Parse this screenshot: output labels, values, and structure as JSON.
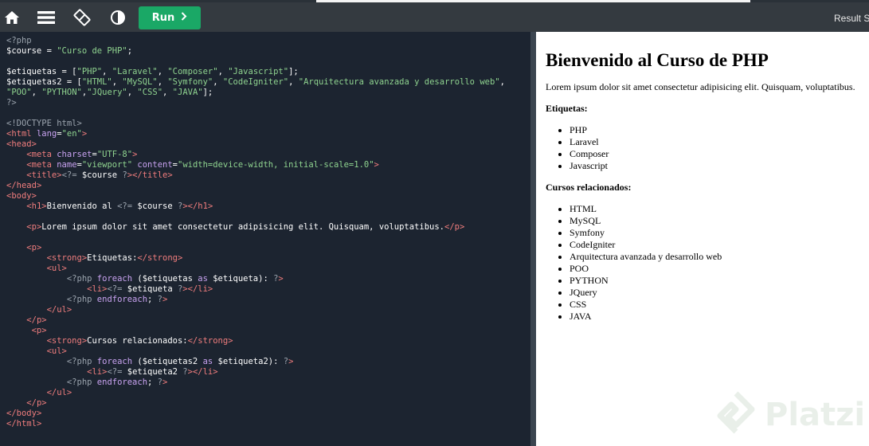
{
  "toolbar": {
    "icons": [
      "home-icon",
      "menu-icon",
      "layout-toggle-icon",
      "theme-contrast-icon"
    ],
    "run_label": "Run",
    "result_tab_label": "Result Si"
  },
  "colors": {
    "toolbar_bg": "#343a40",
    "run_button": "#1aa866",
    "editor_bg": "#1c2430",
    "result_bg": "#ffffff"
  },
  "editor": {
    "code_lines": [
      "<?php",
      "$course = \"Curso de PHP\";",
      "",
      "$etiquetas = [\"PHP\", \"Laravel\", \"Composer\", \"Javascript\"];",
      "$etiquetas2 = [\"HTML\", \"MySQL\", \"Symfony\", \"CodeIgniter\", \"Arquitectura avanzada y desarrollo web\",",
      "\"POO\", \"PYTHON\",\"JQuery\", \"CSS\", \"JAVA\"];",
      "?>",
      "",
      "<!DOCTYPE html>",
      "<html lang=\"en\">",
      "<head>",
      "    <meta charset=\"UTF-8\">",
      "    <meta name=\"viewport\" content=\"width=device-width, initial-scale=1.0\">",
      "    <title><?= $course ?></title>",
      "</head>",
      "<body>",
      "    <h1>Bienvenido al <?= $course ?></h1>",
      "",
      "    <p>Lorem ipsum dolor sit amet consectetur adipisicing elit. Quisquam, voluptatibus.</p>",
      "",
      "    <p>",
      "        <strong>Etiquetas:</strong>",
      "        <ul>",
      "            <?php foreach ($etiquetas as $etiqueta): ?>",
      "                <li><?= $etiqueta ?></li>",
      "            <?php endforeach; ?>",
      "        </ul>",
      "    </p>",
      "     <p>",
      "        <strong>Cursos relacionados:</strong>",
      "        <ul>",
      "            <?php foreach ($etiquetas2 as $etiqueta2): ?>",
      "                <li><?= $etiqueta2 ?></li>",
      "            <?php endforeach; ?>",
      "        </ul>",
      "    </p>",
      "</body>",
      "</html>"
    ]
  },
  "result": {
    "heading": "Bienvenido al Curso de PHP",
    "intro": "Lorem ipsum dolor sit amet consectetur adipisicing elit. Quisquam, voluptatibus.",
    "etiquetas_label": "Etiquetas:",
    "etiquetas": [
      "PHP",
      "Laravel",
      "Composer",
      "Javascript"
    ],
    "cursos_label": "Cursos relacionados:",
    "cursos": [
      "HTML",
      "MySQL",
      "Symfony",
      "CodeIgniter",
      "Arquitectura avanzada y desarrollo web",
      "POO",
      "PYTHON",
      "JQuery",
      "CSS",
      "JAVA"
    ]
  },
  "watermark": {
    "text": "Platzi"
  }
}
